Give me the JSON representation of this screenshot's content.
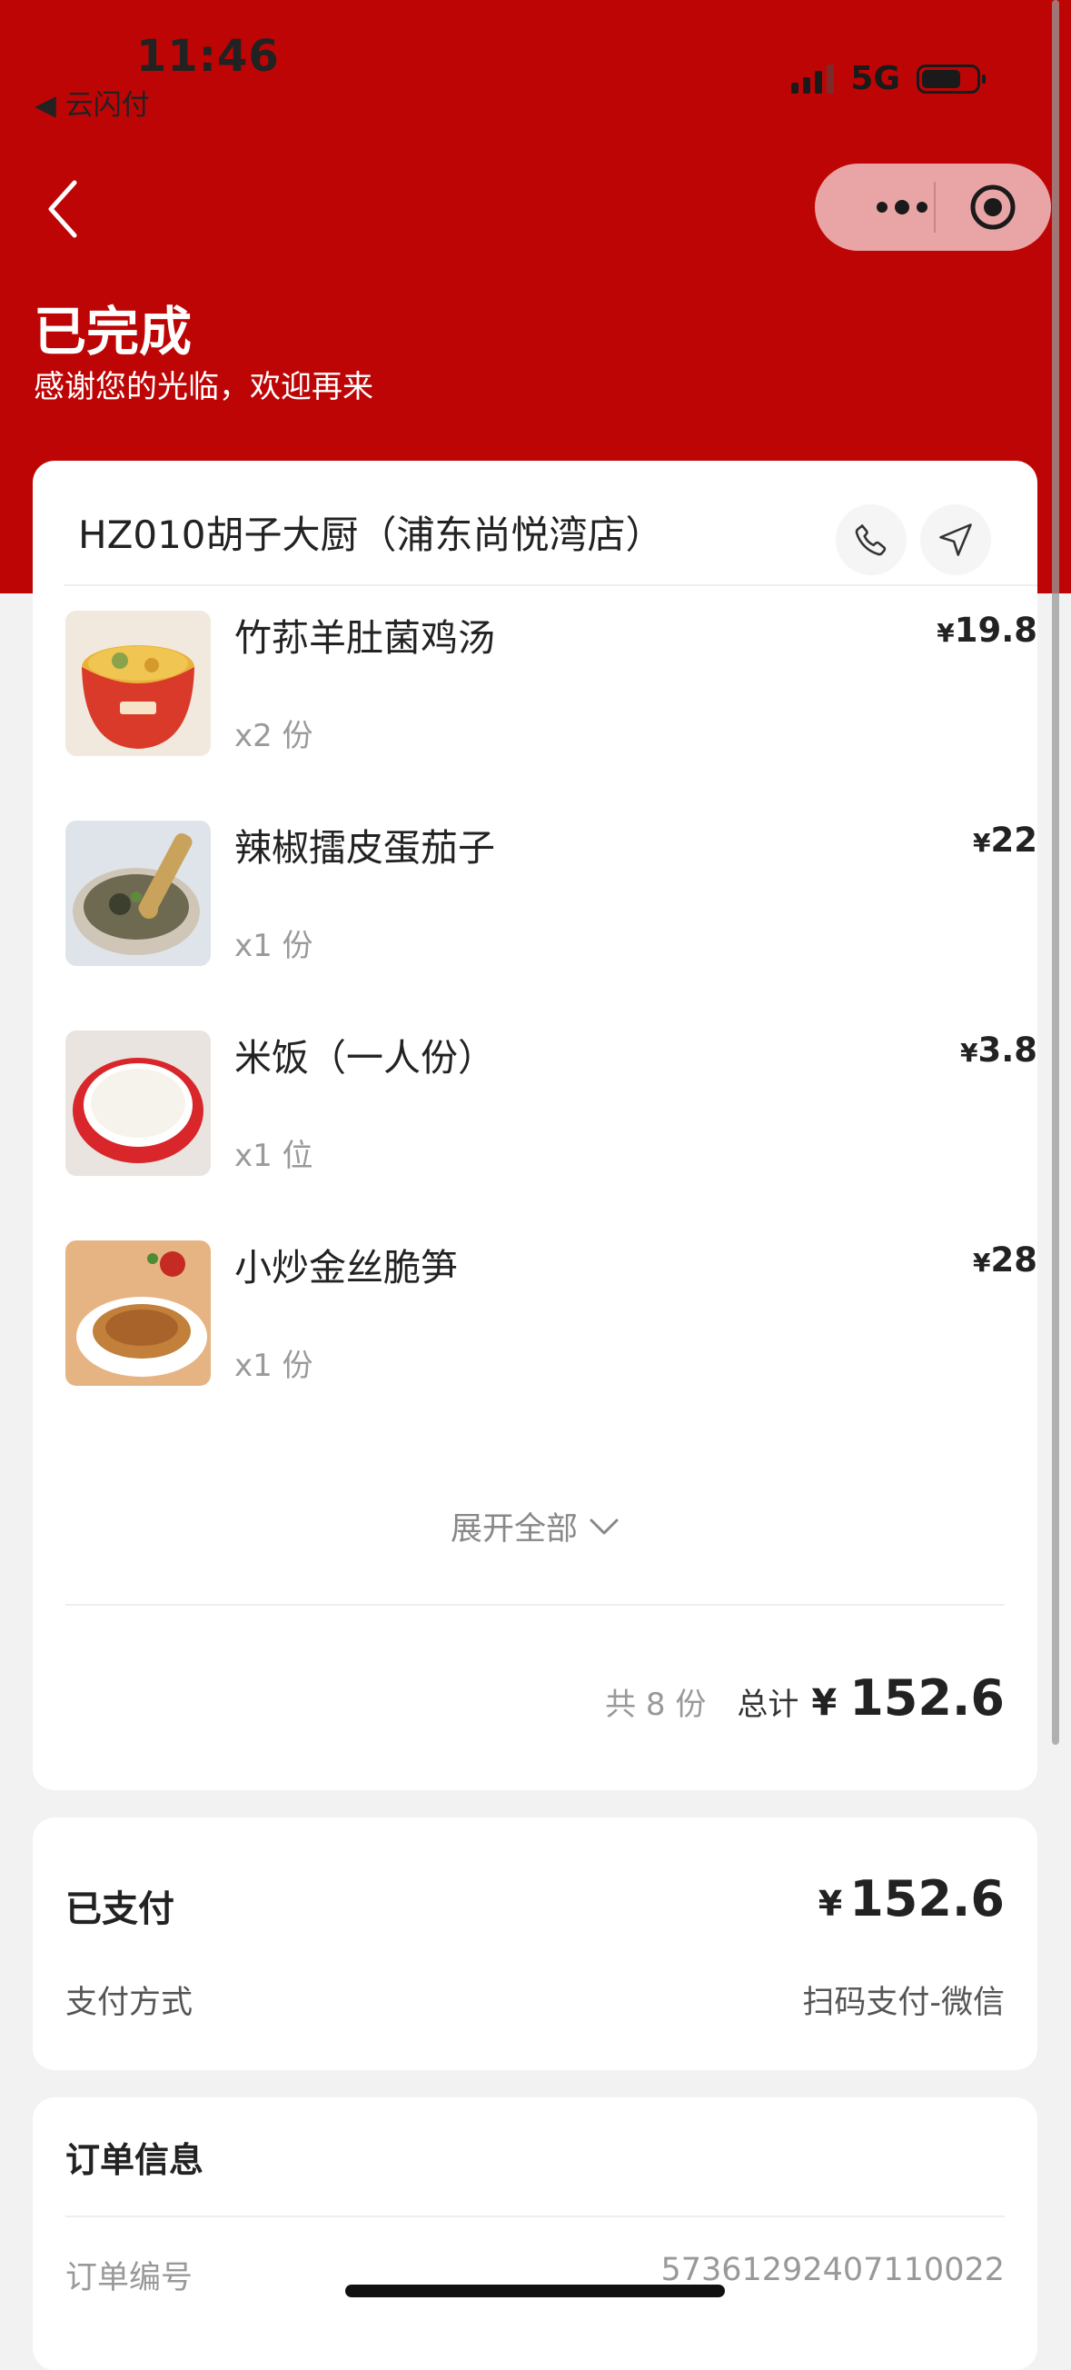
{
  "status_bar": {
    "time": "11:46",
    "back_app": "◀ 云闪付",
    "network": "5G"
  },
  "header": {
    "title": "已完成",
    "subtitle": "感谢您的光临，欢迎再来"
  },
  "store": {
    "name": "HZ010胡子大厨（浦东尚悦湾店）"
  },
  "items": [
    {
      "name": "竹荪羊肚菌鸡汤",
      "qty": "x2 份",
      "price": "19.8"
    },
    {
      "name": "辣椒擂皮蛋茄子",
      "qty": "x1 份",
      "price": "22"
    },
    {
      "name": "米饭（一人份）",
      "qty": "x1 位",
      "price": "3.8"
    },
    {
      "name": "小炒金丝脆笋",
      "qty": "x1 份",
      "price": "28"
    }
  ],
  "currency_symbol": "¥",
  "expand_label": "展开全部",
  "summary": {
    "count": "共 8 份",
    "total_label": "总计",
    "total": "152.6"
  },
  "payment": {
    "paid_label": "已支付",
    "paid_amount": "152.6",
    "method_label": "支付方式",
    "method_value": "扫码支付-微信"
  },
  "order_info": {
    "title": "订单信息",
    "number_label": "订单编号",
    "number_value": "57361292407110022"
  },
  "colors": {
    "brand_red": "#be0505",
    "page_bg": "#f2f2f2",
    "capsule": "#e9a5a5"
  }
}
